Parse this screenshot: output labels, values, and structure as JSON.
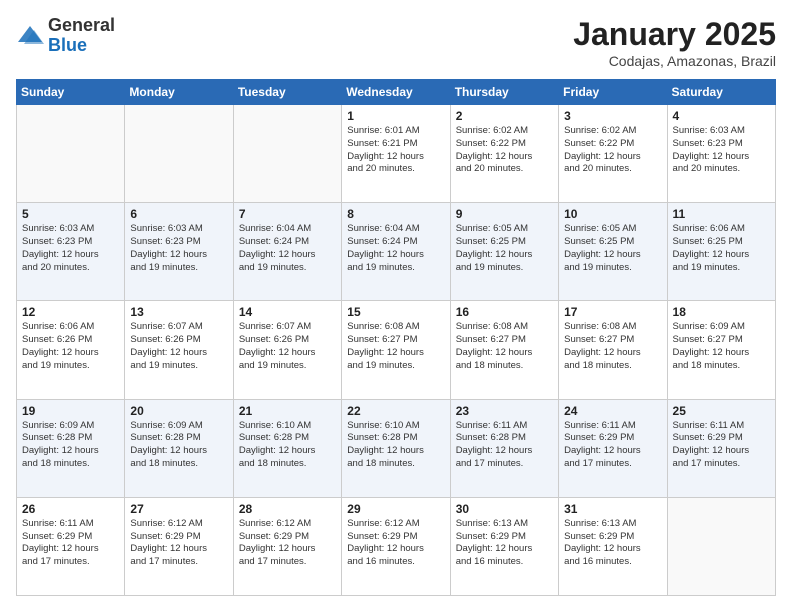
{
  "header": {
    "logo_general": "General",
    "logo_blue": "Blue",
    "month": "January 2025",
    "location": "Codajas, Amazonas, Brazil"
  },
  "weekdays": [
    "Sunday",
    "Monday",
    "Tuesday",
    "Wednesday",
    "Thursday",
    "Friday",
    "Saturday"
  ],
  "weeks": [
    [
      {
        "day": "",
        "info": ""
      },
      {
        "day": "",
        "info": ""
      },
      {
        "day": "",
        "info": ""
      },
      {
        "day": "1",
        "info": "Sunrise: 6:01 AM\nSunset: 6:21 PM\nDaylight: 12 hours\nand 20 minutes."
      },
      {
        "day": "2",
        "info": "Sunrise: 6:02 AM\nSunset: 6:22 PM\nDaylight: 12 hours\nand 20 minutes."
      },
      {
        "day": "3",
        "info": "Sunrise: 6:02 AM\nSunset: 6:22 PM\nDaylight: 12 hours\nand 20 minutes."
      },
      {
        "day": "4",
        "info": "Sunrise: 6:03 AM\nSunset: 6:23 PM\nDaylight: 12 hours\nand 20 minutes."
      }
    ],
    [
      {
        "day": "5",
        "info": "Sunrise: 6:03 AM\nSunset: 6:23 PM\nDaylight: 12 hours\nand 20 minutes."
      },
      {
        "day": "6",
        "info": "Sunrise: 6:03 AM\nSunset: 6:23 PM\nDaylight: 12 hours\nand 19 minutes."
      },
      {
        "day": "7",
        "info": "Sunrise: 6:04 AM\nSunset: 6:24 PM\nDaylight: 12 hours\nand 19 minutes."
      },
      {
        "day": "8",
        "info": "Sunrise: 6:04 AM\nSunset: 6:24 PM\nDaylight: 12 hours\nand 19 minutes."
      },
      {
        "day": "9",
        "info": "Sunrise: 6:05 AM\nSunset: 6:25 PM\nDaylight: 12 hours\nand 19 minutes."
      },
      {
        "day": "10",
        "info": "Sunrise: 6:05 AM\nSunset: 6:25 PM\nDaylight: 12 hours\nand 19 minutes."
      },
      {
        "day": "11",
        "info": "Sunrise: 6:06 AM\nSunset: 6:25 PM\nDaylight: 12 hours\nand 19 minutes."
      }
    ],
    [
      {
        "day": "12",
        "info": "Sunrise: 6:06 AM\nSunset: 6:26 PM\nDaylight: 12 hours\nand 19 minutes."
      },
      {
        "day": "13",
        "info": "Sunrise: 6:07 AM\nSunset: 6:26 PM\nDaylight: 12 hours\nand 19 minutes."
      },
      {
        "day": "14",
        "info": "Sunrise: 6:07 AM\nSunset: 6:26 PM\nDaylight: 12 hours\nand 19 minutes."
      },
      {
        "day": "15",
        "info": "Sunrise: 6:08 AM\nSunset: 6:27 PM\nDaylight: 12 hours\nand 19 minutes."
      },
      {
        "day": "16",
        "info": "Sunrise: 6:08 AM\nSunset: 6:27 PM\nDaylight: 12 hours\nand 18 minutes."
      },
      {
        "day": "17",
        "info": "Sunrise: 6:08 AM\nSunset: 6:27 PM\nDaylight: 12 hours\nand 18 minutes."
      },
      {
        "day": "18",
        "info": "Sunrise: 6:09 AM\nSunset: 6:27 PM\nDaylight: 12 hours\nand 18 minutes."
      }
    ],
    [
      {
        "day": "19",
        "info": "Sunrise: 6:09 AM\nSunset: 6:28 PM\nDaylight: 12 hours\nand 18 minutes."
      },
      {
        "day": "20",
        "info": "Sunrise: 6:09 AM\nSunset: 6:28 PM\nDaylight: 12 hours\nand 18 minutes."
      },
      {
        "day": "21",
        "info": "Sunrise: 6:10 AM\nSunset: 6:28 PM\nDaylight: 12 hours\nand 18 minutes."
      },
      {
        "day": "22",
        "info": "Sunrise: 6:10 AM\nSunset: 6:28 PM\nDaylight: 12 hours\nand 18 minutes."
      },
      {
        "day": "23",
        "info": "Sunrise: 6:11 AM\nSunset: 6:28 PM\nDaylight: 12 hours\nand 17 minutes."
      },
      {
        "day": "24",
        "info": "Sunrise: 6:11 AM\nSunset: 6:29 PM\nDaylight: 12 hours\nand 17 minutes."
      },
      {
        "day": "25",
        "info": "Sunrise: 6:11 AM\nSunset: 6:29 PM\nDaylight: 12 hours\nand 17 minutes."
      }
    ],
    [
      {
        "day": "26",
        "info": "Sunrise: 6:11 AM\nSunset: 6:29 PM\nDaylight: 12 hours\nand 17 minutes."
      },
      {
        "day": "27",
        "info": "Sunrise: 6:12 AM\nSunset: 6:29 PM\nDaylight: 12 hours\nand 17 minutes."
      },
      {
        "day": "28",
        "info": "Sunrise: 6:12 AM\nSunset: 6:29 PM\nDaylight: 12 hours\nand 17 minutes."
      },
      {
        "day": "29",
        "info": "Sunrise: 6:12 AM\nSunset: 6:29 PM\nDaylight: 12 hours\nand 16 minutes."
      },
      {
        "day": "30",
        "info": "Sunrise: 6:13 AM\nSunset: 6:29 PM\nDaylight: 12 hours\nand 16 minutes."
      },
      {
        "day": "31",
        "info": "Sunrise: 6:13 AM\nSunset: 6:29 PM\nDaylight: 12 hours\nand 16 minutes."
      },
      {
        "day": "",
        "info": ""
      }
    ]
  ]
}
